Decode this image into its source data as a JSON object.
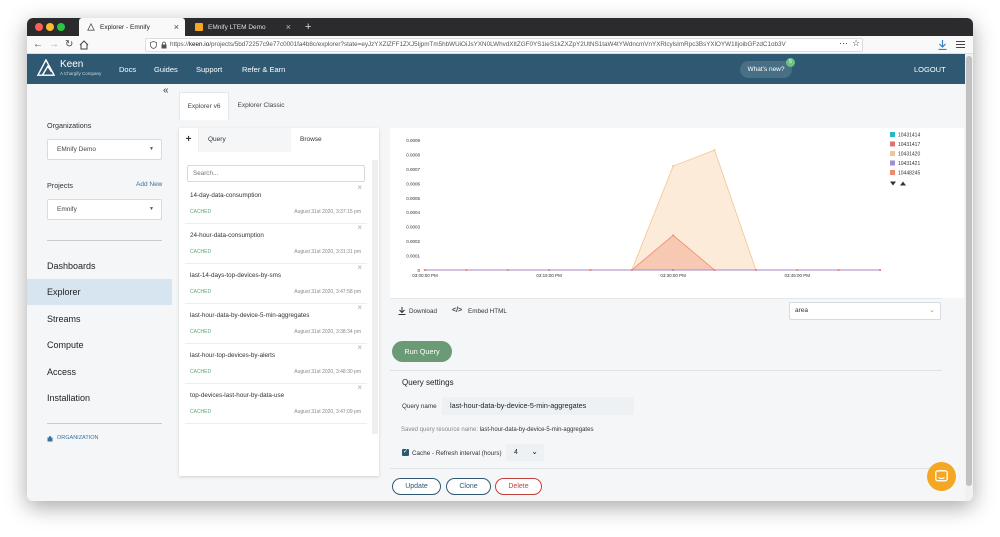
{
  "browser": {
    "tabs": [
      {
        "title": "Explorer - Emnify",
        "active": true
      },
      {
        "title": "EMnify LTEM Demo",
        "active": false
      }
    ],
    "new_tab": "+",
    "close": "×",
    "url_domain": "keen.io",
    "url_prefix": "https://",
    "url_rest": "/projects/5bd72257c9e77c0001fa4b8c/explorer?state=eyJzYXZlZFF1ZXJ5IjpmTm5hbWUiOiJsYXN0LWhvdXItZGF0YS1ieS1kZXZpY2UtNS1taW4tYWdncmVnYXRlcylsImRpc3BsYXlOYW1lIjoibGFzdC1ob3V",
    "menu": "⋯"
  },
  "header": {
    "logo_text": "Keen",
    "logo_sub": "A Chargify Company",
    "nav": [
      "Docs",
      "Guides",
      "Support",
      "Refer & Earn"
    ],
    "whats_new": "What's new?",
    "whats_new_count": "5",
    "logout": "LOGOUT"
  },
  "sidebar": {
    "collapse": "«",
    "organizations_label": "Organizations",
    "organization": "EMnify Demo",
    "projects_label": "Projects",
    "add_new": "Add New",
    "project": "Emnify",
    "nav": [
      {
        "label": "Dashboards",
        "active": false
      },
      {
        "label": "Explorer",
        "active": true
      },
      {
        "label": "Streams",
        "active": false
      },
      {
        "label": "Compute",
        "active": false
      },
      {
        "label": "Access",
        "active": false
      },
      {
        "label": "Installation",
        "active": false
      }
    ],
    "organization_link": "ORGANIZATION"
  },
  "explorer": {
    "version_tabs": [
      "Explorer v6",
      "Explorer Classic"
    ],
    "add": "+",
    "panel_tabs": [
      "Query",
      "Browse"
    ],
    "search_placeholder": "Search...",
    "queries": [
      {
        "name": "14-day-data-consumption",
        "status": "CACHED",
        "date": "August 31st 2020, 3:37:15 pm"
      },
      {
        "name": "24-hour-data-consumption",
        "status": "CACHED",
        "date": "August 31st 2020, 3:31:31 pm"
      },
      {
        "name": "last-14-days-top-devices-by-sms",
        "status": "CACHED",
        "date": "August 31st 2020, 3:47:58 pm"
      },
      {
        "name": "last-hour-data-by-device-5-min-aggregates",
        "status": "CACHED",
        "date": "August 31st 2020, 3:38:34 pm"
      },
      {
        "name": "last-hour-top-devices-by-alerts",
        "status": "CACHED",
        "date": "August 31st 2020, 3:48:30 pm"
      },
      {
        "name": "top-devices-last-hour-by-data-use",
        "status": "CACHED",
        "date": "August 31st 2020, 3:47:09 pm"
      }
    ]
  },
  "toolbar": {
    "download": "Download",
    "embed": "Embed HTML",
    "chart_type": "area"
  },
  "run_query": "Run Query",
  "settings": {
    "title": "Query settings",
    "name_label": "Query name",
    "name_value": "last-hour-data-by-device-5-min-aggregates",
    "resource_label": "Saved query resource name:",
    "resource_value": "last-hour-data-by-device-5-min-aggregates",
    "cache_label": "Cache",
    "refresh_label": "- Refresh interval (hours)",
    "refresh_value": "4",
    "buttons": {
      "update": "Update",
      "clone": "Clone",
      "delete": "Delete"
    }
  },
  "colors": {
    "header": "#2f5972",
    "active_nav": "#d6e5ef",
    "run": "#6a9b74",
    "update_border": "#2f5972",
    "clone_border": "#2f5972",
    "delete_border": "#c0413e",
    "cached": "#55a870",
    "chat": "#f5a623"
  },
  "chart_data": {
    "type": "area",
    "x": [
      "03:00:00 PM",
      "03:05:00 PM",
      "03:10:00 PM",
      "03:15:00 PM",
      "03:20:00 PM",
      "03:25:00 PM",
      "03:30:00 PM",
      "03:35:00 PM",
      "03:40:00 PM",
      "03:45:00 PM",
      "03:50:00 PM",
      "03:55:00 PM"
    ],
    "x_tick_labels": [
      "03:00:00 PM",
      "03:15:00 PM",
      "03:30:00 PM",
      "03:45:00 PM"
    ],
    "y_ticks": [
      "0",
      "0.0001",
      "0.0002",
      "0.0003",
      "0.0004",
      "0.0005",
      "0.0006",
      "0.0007",
      "0.0008",
      "0.0009"
    ],
    "ylim": [
      0,
      0.0009
    ],
    "series": [
      {
        "name": "10431414",
        "color": "#26b5c4",
        "values": [
          0,
          0,
          0,
          0,
          0,
          0,
          0,
          0,
          0,
          0,
          0,
          0
        ]
      },
      {
        "name": "10431417",
        "color": "#e0707a",
        "values": [
          0,
          0,
          0,
          0,
          0,
          0,
          0,
          0,
          0,
          0,
          0,
          0
        ]
      },
      {
        "name": "10431420",
        "color": "#f3c58f",
        "values": [
          0,
          0,
          0,
          0,
          0,
          0,
          0.00072,
          0.00083,
          0,
          0,
          0,
          0
        ]
      },
      {
        "name": "10431421",
        "color": "#9c8fd6",
        "values": [
          0,
          0,
          0,
          0,
          0,
          0,
          0,
          0,
          0,
          0,
          0,
          0
        ]
      },
      {
        "name": "10448245",
        "color": "#f08a6e",
        "values": [
          0,
          0,
          0,
          0,
          0,
          0,
          0.00024,
          0,
          0,
          0,
          0,
          0
        ]
      }
    ],
    "legend_position": "right",
    "grid": false
  }
}
